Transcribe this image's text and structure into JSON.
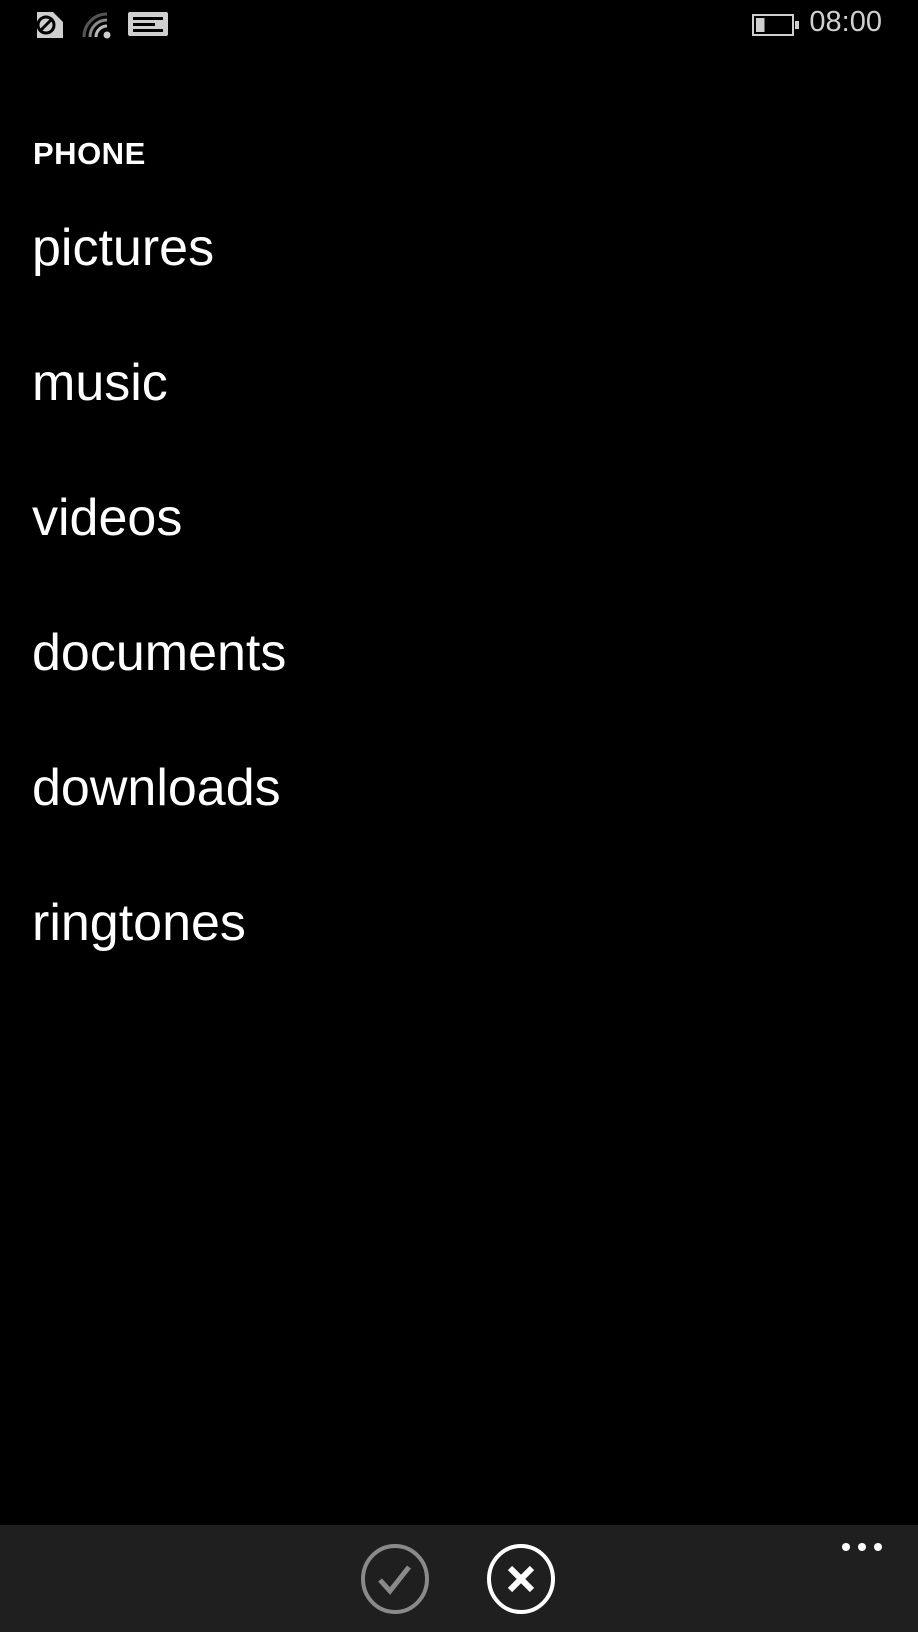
{
  "status_bar": {
    "icons": [
      "sim-blocked-icon",
      "wifi-icon",
      "message-icon"
    ],
    "battery_level": 0.25,
    "time": "08:00"
  },
  "header": {
    "title": "PHONE"
  },
  "folders": [
    {
      "label": "pictures"
    },
    {
      "label": "music"
    },
    {
      "label": "videos"
    },
    {
      "label": "documents"
    },
    {
      "label": "downloads"
    },
    {
      "label": "ringtones"
    }
  ],
  "app_bar": {
    "buttons": [
      {
        "name": "accept",
        "icon": "check-icon",
        "enabled": false
      },
      {
        "name": "cancel",
        "icon": "close-icon",
        "enabled": true
      }
    ],
    "more_icon": "ellipsis-icon",
    "colors": {
      "background": "#1f1f1f",
      "disabled": "#8a8a8a",
      "enabled": "#ffffff"
    }
  }
}
